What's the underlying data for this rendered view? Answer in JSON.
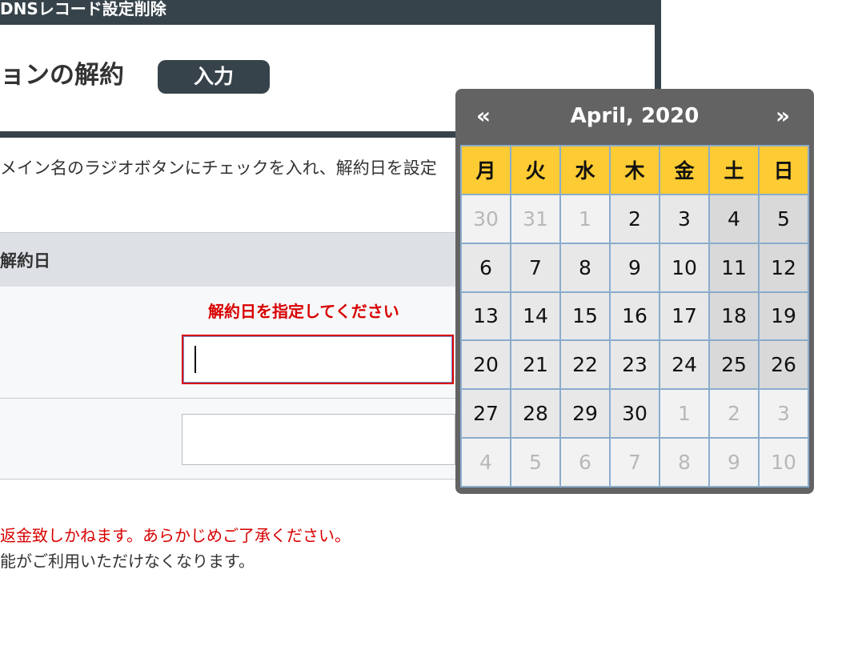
{
  "header": {
    "title": "DNSレコード設定削除",
    "page_title": "ョンの解約",
    "step_badge": "入力"
  },
  "instruction": "メイン名のラジオボタンにチェックを入れ、解約日を設定",
  "table": {
    "header_label": "解約日",
    "error_message": "解約日を指定してください",
    "date_input_value": "",
    "second_input_value": ""
  },
  "notes": {
    "red": "返金致しかねます。あらかじめご了承ください。",
    "gray": "能がご利用いただけなくなります。"
  },
  "calendar": {
    "title": "April, 2020",
    "prev": "«",
    "next": "»",
    "weekdays": [
      "月",
      "火",
      "水",
      "木",
      "金",
      "土",
      "日"
    ],
    "days": [
      {
        "label": "30",
        "muted": true
      },
      {
        "label": "31",
        "muted": true
      },
      {
        "label": "1",
        "muted": true
      },
      {
        "label": "2",
        "muted": false
      },
      {
        "label": "3",
        "muted": false
      },
      {
        "label": "4",
        "muted": false
      },
      {
        "label": "5",
        "muted": false
      },
      {
        "label": "6",
        "muted": false
      },
      {
        "label": "7",
        "muted": false
      },
      {
        "label": "8",
        "muted": false
      },
      {
        "label": "9",
        "muted": false
      },
      {
        "label": "10",
        "muted": false
      },
      {
        "label": "11",
        "muted": false
      },
      {
        "label": "12",
        "muted": false
      },
      {
        "label": "13",
        "muted": false
      },
      {
        "label": "14",
        "muted": false
      },
      {
        "label": "15",
        "muted": false
      },
      {
        "label": "16",
        "muted": false
      },
      {
        "label": "17",
        "muted": false
      },
      {
        "label": "18",
        "muted": false
      },
      {
        "label": "19",
        "muted": false
      },
      {
        "label": "20",
        "muted": false
      },
      {
        "label": "21",
        "muted": false
      },
      {
        "label": "22",
        "muted": false
      },
      {
        "label": "23",
        "muted": false
      },
      {
        "label": "24",
        "muted": false
      },
      {
        "label": "25",
        "muted": false
      },
      {
        "label": "26",
        "muted": false
      },
      {
        "label": "27",
        "muted": false
      },
      {
        "label": "28",
        "muted": false
      },
      {
        "label": "29",
        "muted": false
      },
      {
        "label": "30",
        "muted": false
      },
      {
        "label": "1",
        "muted": true
      },
      {
        "label": "2",
        "muted": true
      },
      {
        "label": "3",
        "muted": true
      },
      {
        "label": "4",
        "muted": true
      },
      {
        "label": "5",
        "muted": true
      },
      {
        "label": "6",
        "muted": true
      },
      {
        "label": "7",
        "muted": true
      },
      {
        "label": "8",
        "muted": true
      },
      {
        "label": "9",
        "muted": true
      },
      {
        "label": "10",
        "muted": true
      }
    ]
  },
  "colors": {
    "accent_dark": "#37434b",
    "error": "#d80000",
    "calendar_header": "#636363",
    "weekday_header": "#fdcb33",
    "grid_border": "#8aaccd"
  }
}
